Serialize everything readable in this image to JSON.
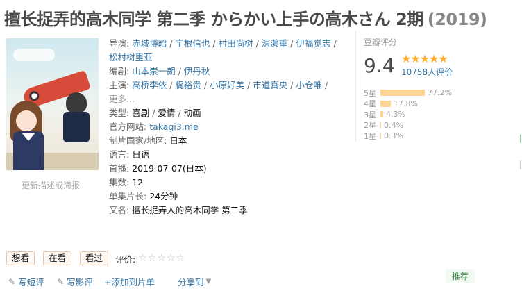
{
  "title": {
    "main": "擅长捉弄的高木同学 第二季 からかい上手の高木さん 2期",
    "year": "(2019)"
  },
  "poster": {
    "link_text": "更新描述或海报"
  },
  "info": {
    "director_label": "导演:",
    "directors": [
      "赤城博昭",
      "宇根信也",
      "村田尚树",
      "深濑重",
      "伊福觉志",
      "松村树里亚"
    ],
    "writer_label": "编剧:",
    "writers": [
      "山本崇一朗",
      "伊丹秋"
    ],
    "cast_label": "主演:",
    "cast": [
      "高桥李依",
      "梶裕贵",
      "小原好美",
      "市道真央",
      "小仓唯"
    ],
    "more": "更多...",
    "genre_label": "类型:",
    "genres": [
      "喜剧",
      "爱情",
      "动画"
    ],
    "site_label": "官方网站:",
    "site": "takagi3.me",
    "region_label": "制片国家/地区:",
    "region": "日本",
    "language_label": "语言:",
    "language": "日语",
    "premiere_label": "首播:",
    "premiere": "2019-07-07(日本)",
    "episodes_label": "集数:",
    "episodes": "12",
    "runtime_label": "单集片长:",
    "runtime": "24分钟",
    "aka_label": "又名:",
    "aka": "擅长捉弄人的高木同学 第二季"
  },
  "rating": {
    "label": "豆瓣评分",
    "score": "9.4",
    "stars": "★★★★★",
    "votes": "10758人评价",
    "distribution": [
      {
        "star": "5星",
        "pct": "77.2%",
        "value": 77.2
      },
      {
        "star": "4星",
        "pct": "17.8%",
        "value": 17.8
      },
      {
        "star": "3星",
        "pct": "4.3%",
        "value": 4.3
      },
      {
        "star": "2星",
        "pct": "0.4%",
        "value": 0.4
      },
      {
        "star": "1星",
        "pct": "0.3%",
        "value": 0.3
      }
    ]
  },
  "actions": {
    "want": "想看",
    "watching": "在看",
    "watched": "看过",
    "rate_label": "评价:",
    "rate_stars": "☆☆☆☆☆"
  },
  "bottom": {
    "short_review": "写短评",
    "review": "写影评",
    "add_list": "+添加到片单",
    "share": "分享到",
    "recommend": "推荐"
  },
  "icons": {
    "short_review_icon": "pencil",
    "review_icon": "pencil-square",
    "share_caret": "chevron-down"
  },
  "colors": {
    "link": "#3377aa",
    "star": "#ffac2d",
    "bar": "#ffd596",
    "recommend": "#3d8e52"
  }
}
